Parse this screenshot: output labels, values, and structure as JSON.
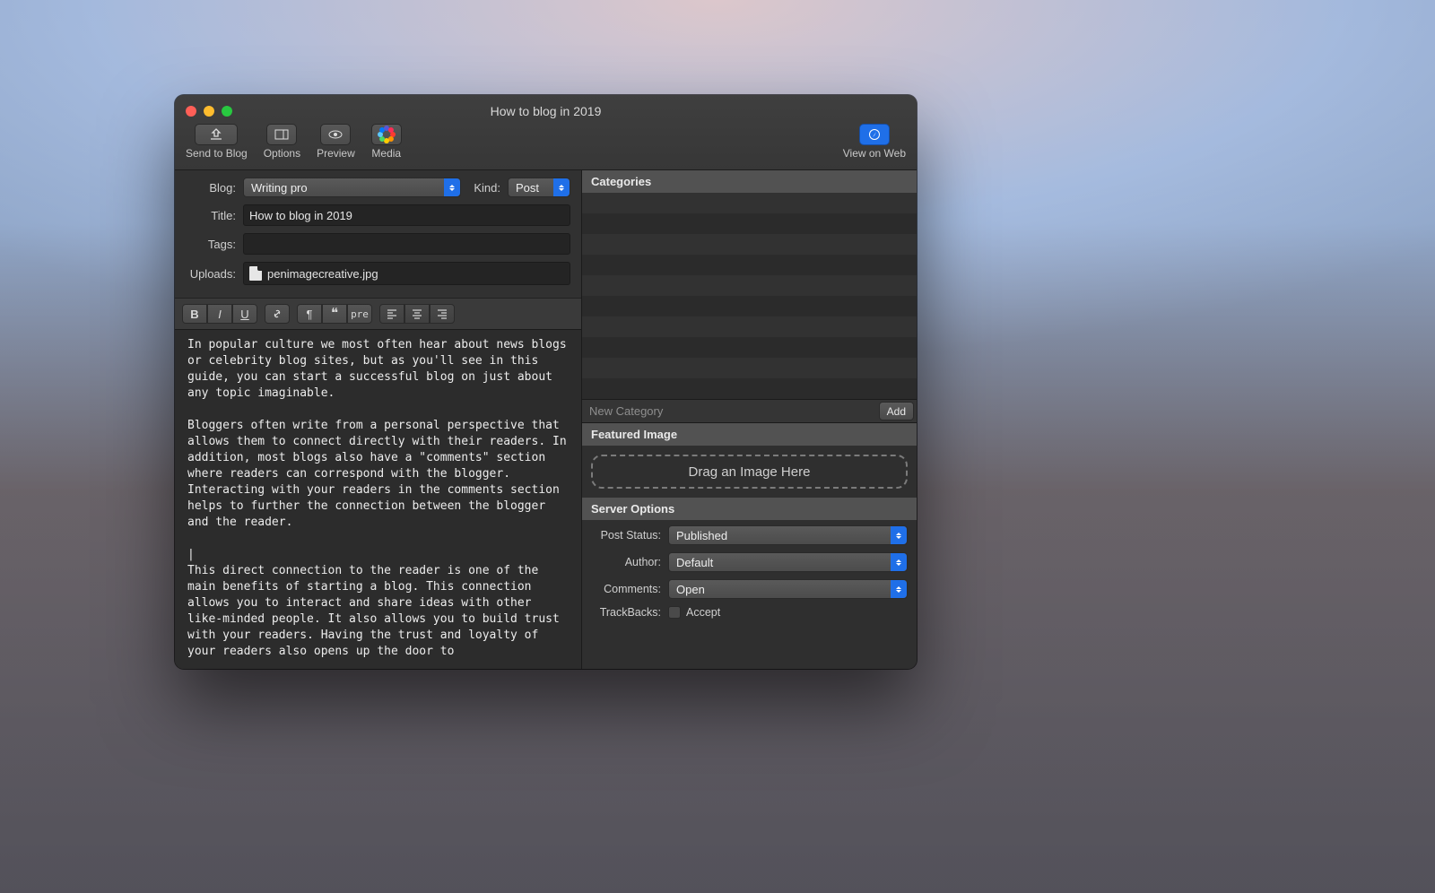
{
  "window": {
    "title": "How to blog in 2019"
  },
  "toolbar": {
    "send": "Send to Blog",
    "options": "Options",
    "preview": "Preview",
    "media": "Media",
    "view_web": "View on Web"
  },
  "meta": {
    "blog_label": "Blog:",
    "blog_value": "Writing pro",
    "kind_label": "Kind:",
    "kind_value": "Post",
    "title_label": "Title:",
    "title_value": "How to blog in 2019",
    "tags_label": "Tags:",
    "tags_value": "",
    "uploads_label": "Uploads:",
    "uploads_file": "penimagecreative.jpg"
  },
  "editor": {
    "body": "In popular culture we most often hear about news blogs or celebrity blog sites, but as you'll see in this guide, you can start a successful blog on just about any topic imaginable.\n\nBloggers often write from a personal perspective that allows them to connect directly with their readers. In addition, most blogs also have a \"comments\" section where readers can correspond with the blogger. Interacting with your readers in the comments section helps to further the connection between the blogger and the reader.\n\n|\nThis direct connection to the reader is one of the main benefits of starting a blog. This connection allows you to interact and share ideas with other like-minded people. It also allows you to build trust with your readers. Having the trust and loyalty of your readers also opens up the door to"
  },
  "sidebar": {
    "categories_header": "Categories",
    "newcat_placeholder": "New Category",
    "add_label": "Add",
    "featured_header": "Featured Image",
    "dropzone": "Drag an Image Here",
    "server_header": "Server Options"
  },
  "server": {
    "post_status_label": "Post Status:",
    "post_status_value": "Published",
    "author_label": "Author:",
    "author_value": "Default",
    "comments_label": "Comments:",
    "comments_value": "Open",
    "trackbacks_label": "TrackBacks:",
    "trackbacks_accept": "Accept"
  }
}
